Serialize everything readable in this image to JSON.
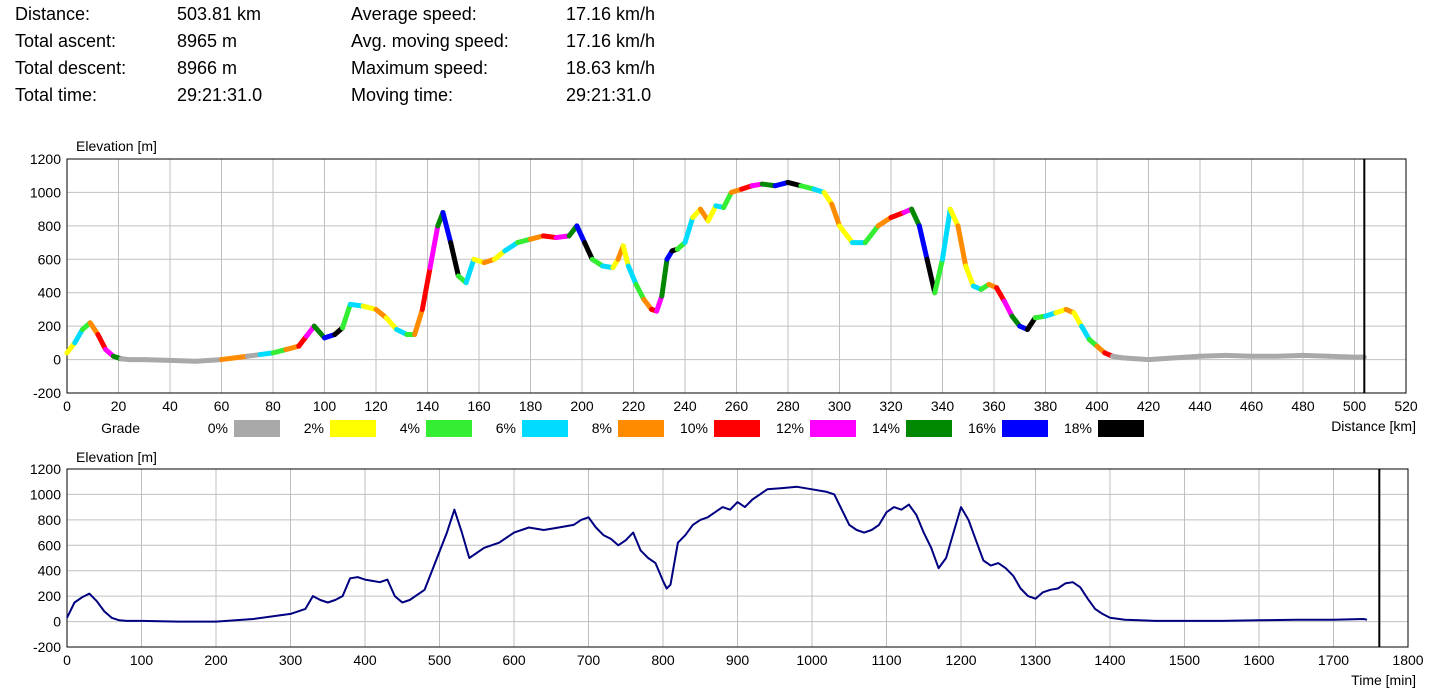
{
  "stats": {
    "left": [
      {
        "label": "Distance:",
        "value": "503.81 km"
      },
      {
        "label": "Total ascent:",
        "value": "8965 m"
      },
      {
        "label": "Total descent:",
        "value": "8966 m"
      },
      {
        "label": "Total time:",
        "value": "29:21:31.0"
      }
    ],
    "right": [
      {
        "label": "Average speed:",
        "value": "17.16 km/h"
      },
      {
        "label": "Avg. moving speed:",
        "value": "17.16 km/h"
      },
      {
        "label": "Maximum speed:",
        "value": "18.63 km/h"
      },
      {
        "label": "Moving time:",
        "value": "29:21:31.0"
      }
    ]
  },
  "chart_data": [
    {
      "type": "line",
      "ylabel": "Elevation [m]",
      "xlabel": "Distance [km]",
      "xlim": [
        0,
        520
      ],
      "ylim": [
        -200,
        1200
      ],
      "xticks": [
        0,
        20,
        40,
        60,
        80,
        100,
        120,
        140,
        160,
        180,
        200,
        220,
        240,
        260,
        280,
        300,
        320,
        340,
        360,
        380,
        400,
        420,
        440,
        460,
        480,
        500,
        520
      ],
      "yticks": [
        -200,
        0,
        200,
        400,
        600,
        800,
        1000,
        1200
      ],
      "marker_x": 503.81,
      "grid": true,
      "legend": {
        "title": "Grade",
        "position": "bottom",
        "entries": [
          {
            "label": "0%",
            "color": "#a9a9a9"
          },
          {
            "label": "2%",
            "color": "#ffff00"
          },
          {
            "label": "4%",
            "color": "#33ee33"
          },
          {
            "label": "6%",
            "color": "#00dcff"
          },
          {
            "label": "8%",
            "color": "#ff8c00"
          },
          {
            "label": "10%",
            "color": "#ff0000"
          },
          {
            "label": "12%",
            "color": "#ff00ff"
          },
          {
            "label": "14%",
            "color": "#008800"
          },
          {
            "label": "16%",
            "color": "#0000ff"
          },
          {
            "label": "18%",
            "color": "#000000"
          }
        ]
      },
      "x": [
        0,
        3,
        6,
        9,
        12,
        15,
        18,
        21,
        24,
        30,
        40,
        50,
        60,
        70,
        75,
        80,
        85,
        90,
        93,
        96,
        100,
        104,
        107,
        110,
        115,
        120,
        124,
        128,
        132,
        135,
        138,
        141,
        144,
        146,
        149,
        152,
        155,
        158,
        162,
        166,
        170,
        175,
        180,
        185,
        190,
        195,
        198,
        201,
        204,
        208,
        212,
        214,
        216,
        218,
        221,
        224,
        227,
        229,
        231,
        233,
        235,
        237,
        240,
        243,
        246,
        249,
        252,
        255,
        258,
        262,
        266,
        270,
        275,
        280,
        285,
        290,
        294,
        297,
        300,
        305,
        310,
        315,
        320,
        325,
        328,
        331,
        334,
        337,
        340,
        343,
        346,
        349,
        352,
        355,
        358,
        361,
        364,
        367,
        370,
        373,
        376,
        380,
        384,
        388,
        391,
        394,
        397,
        400,
        403,
        406,
        410,
        415,
        420,
        430,
        440,
        450,
        460,
        470,
        480,
        490,
        500,
        503.81
      ],
      "y": [
        40,
        100,
        180,
        220,
        150,
        60,
        20,
        5,
        0,
        0,
        -5,
        -10,
        0,
        20,
        30,
        40,
        60,
        80,
        140,
        200,
        130,
        150,
        190,
        330,
        320,
        300,
        250,
        180,
        150,
        150,
        300,
        550,
        800,
        880,
        700,
        500,
        460,
        600,
        580,
        600,
        650,
        700,
        720,
        740,
        730,
        740,
        800,
        700,
        600,
        560,
        550,
        600,
        680,
        560,
        450,
        360,
        300,
        290,
        380,
        600,
        650,
        660,
        700,
        850,
        900,
        830,
        920,
        910,
        1000,
        1020,
        1040,
        1050,
        1040,
        1060,
        1040,
        1020,
        1000,
        930,
        800,
        700,
        700,
        800,
        850,
        880,
        900,
        800,
        600,
        400,
        600,
        900,
        800,
        560,
        440,
        420,
        450,
        430,
        350,
        260,
        200,
        180,
        250,
        260,
        280,
        300,
        280,
        200,
        120,
        80,
        40,
        20,
        10,
        5,
        0,
        10,
        20,
        25,
        20,
        20,
        25,
        20,
        15,
        15
      ],
      "grade_colors": [
        "#ffff00",
        "#00dcff",
        "#33ee33",
        "#ff8c00",
        "#ff0000",
        "#ff00ff",
        "#008800",
        "#0000ff",
        "#000000",
        "#33ee33",
        "#00dcff",
        "#ffff00",
        "#ff8c00"
      ]
    },
    {
      "type": "line",
      "ylabel": "Elevation [m]",
      "xlabel": "Time [min]",
      "xlim": [
        0,
        1800
      ],
      "ylim": [
        -200,
        1200
      ],
      "xticks": [
        0,
        100,
        200,
        300,
        400,
        500,
        600,
        700,
        800,
        900,
        1000,
        1100,
        1200,
        1300,
        1400,
        1500,
        1600,
        1700,
        1800
      ],
      "yticks": [
        -200,
        0,
        200,
        400,
        600,
        800,
        1000,
        1200
      ],
      "marker_x": 1761.5,
      "grid": true,
      "series": [
        {
          "color": "#000080"
        }
      ],
      "x": [
        0,
        10,
        20,
        30,
        40,
        50,
        60,
        70,
        80,
        100,
        150,
        200,
        250,
        300,
        320,
        330,
        340,
        350,
        360,
        370,
        380,
        390,
        400,
        410,
        420,
        430,
        440,
        450,
        460,
        480,
        500,
        510,
        520,
        530,
        540,
        560,
        580,
        600,
        620,
        640,
        660,
        680,
        690,
        700,
        710,
        720,
        730,
        740,
        750,
        760,
        770,
        780,
        790,
        800,
        805,
        810,
        820,
        830,
        840,
        850,
        860,
        870,
        880,
        890,
        900,
        910,
        920,
        930,
        940,
        960,
        980,
        1000,
        1020,
        1030,
        1040,
        1050,
        1060,
        1070,
        1080,
        1090,
        1100,
        1110,
        1120,
        1130,
        1140,
        1150,
        1160,
        1170,
        1180,
        1190,
        1200,
        1210,
        1220,
        1230,
        1240,
        1250,
        1260,
        1270,
        1280,
        1290,
        1300,
        1310,
        1320,
        1330,
        1340,
        1350,
        1360,
        1370,
        1380,
        1390,
        1400,
        1420,
        1440,
        1460,
        1500,
        1550,
        1600,
        1650,
        1700,
        1740,
        1745
      ],
      "y": [
        30,
        150,
        190,
        220,
        160,
        80,
        30,
        10,
        5,
        5,
        0,
        0,
        20,
        60,
        100,
        200,
        170,
        150,
        170,
        200,
        340,
        350,
        330,
        320,
        310,
        330,
        200,
        150,
        170,
        250,
        550,
        700,
        880,
        700,
        500,
        580,
        620,
        700,
        740,
        720,
        740,
        760,
        800,
        820,
        740,
        680,
        650,
        600,
        640,
        700,
        560,
        500,
        460,
        320,
        260,
        290,
        620,
        680,
        760,
        800,
        820,
        860,
        900,
        880,
        940,
        900,
        960,
        1000,
        1040,
        1050,
        1060,
        1040,
        1020,
        1000,
        880,
        760,
        720,
        700,
        720,
        760,
        860,
        900,
        880,
        920,
        840,
        700,
        580,
        420,
        500,
        700,
        900,
        800,
        640,
        480,
        440,
        460,
        420,
        360,
        260,
        200,
        180,
        230,
        250,
        260,
        300,
        310,
        270,
        180,
        100,
        60,
        30,
        15,
        10,
        5,
        5,
        5,
        10,
        15,
        15,
        20,
        15
      ]
    }
  ]
}
